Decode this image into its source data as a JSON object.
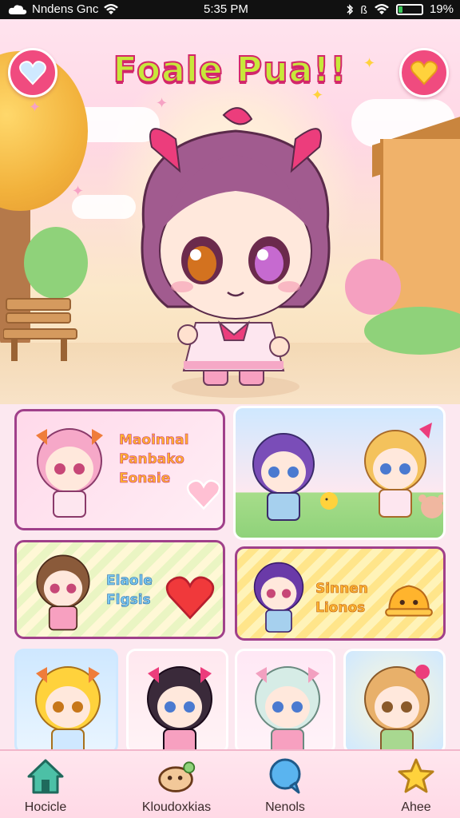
{
  "status_bar": {
    "carrier": "Nndens Gnc",
    "time": "5:35 PM",
    "battery_text": "19%",
    "battery_level": 0.19
  },
  "header": {
    "title": "Foale Pua!!",
    "left_button_icon": "heart-icon",
    "right_button_icon": "heart-icon"
  },
  "cards": [
    {
      "label_lines": [
        "Maoinnal",
        "Panbako",
        "Eonaie"
      ],
      "theme_color": "#a0408a"
    },
    {
      "label_lines": [],
      "theme_color": "#ffffff"
    },
    {
      "label_lines": [
        "Elaole",
        "Flgsis"
      ],
      "theme_color": "#a0408a"
    },
    {
      "label_lines": [
        "Sinnen",
        "Lionos"
      ],
      "theme_color": "#a0408a"
    }
  ],
  "nav": [
    {
      "label": "Hocicle",
      "icon": "home-icon"
    },
    {
      "label": "Kloudoxkias",
      "icon": "pet-icon"
    },
    {
      "label": "Nenols",
      "icon": "chat-bubble-icon"
    },
    {
      "label": "Ahee",
      "icon": "star-icon"
    }
  ],
  "colors": {
    "accent_pink": "#f04b7f",
    "title_fill": "#c7e83a",
    "card_border": "#a0408a"
  }
}
